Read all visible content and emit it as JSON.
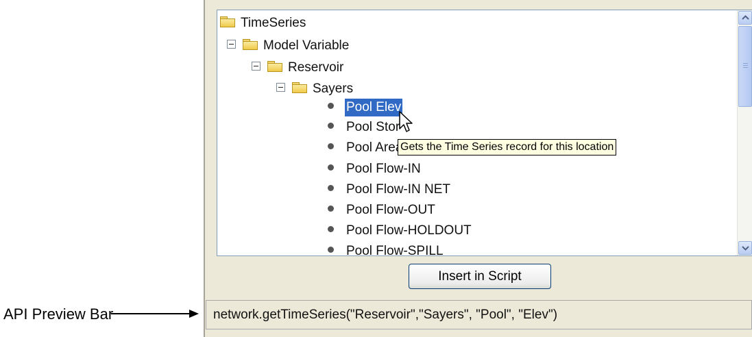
{
  "tree": {
    "items": [
      {
        "label": "TimeSeries",
        "type": "folder"
      },
      {
        "label": "Model Variable",
        "type": "folder"
      },
      {
        "label": "Reservoir",
        "type": "folder"
      },
      {
        "label": "Sayers",
        "type": "folder"
      },
      {
        "label": "Pool Elev",
        "type": "leaf",
        "selected": true
      },
      {
        "label": "Pool Stor",
        "type": "leaf"
      },
      {
        "label": "Pool Area",
        "type": "leaf"
      },
      {
        "label": "Pool Flow-IN",
        "type": "leaf"
      },
      {
        "label": "Pool Flow-IN NET",
        "type": "leaf"
      },
      {
        "label": "Pool Flow-OUT",
        "type": "leaf"
      },
      {
        "label": "Pool Flow-HOLDOUT",
        "type": "leaf"
      },
      {
        "label": "Pool Flow-SPILL",
        "type": "leaf"
      }
    ]
  },
  "tooltip": "Gets the Time Series record for this location",
  "insert_button_label": "Insert in Script",
  "preview_bar_text": "network.getTimeSeries(\"Reservoir\",\"Sayers\", \"Pool\", \"Elev\")",
  "annotation_label": "API Preview Bar",
  "colors": {
    "selection": "#316ac5",
    "panel_background": "#ece9d8",
    "tooltip_background": "#ffffe1"
  },
  "icons": [
    "folder-icon",
    "collapse-icon",
    "bullet-icon",
    "scroll-up-icon",
    "scroll-down-icon",
    "mouse-cursor-icon",
    "arrow-icon"
  ]
}
